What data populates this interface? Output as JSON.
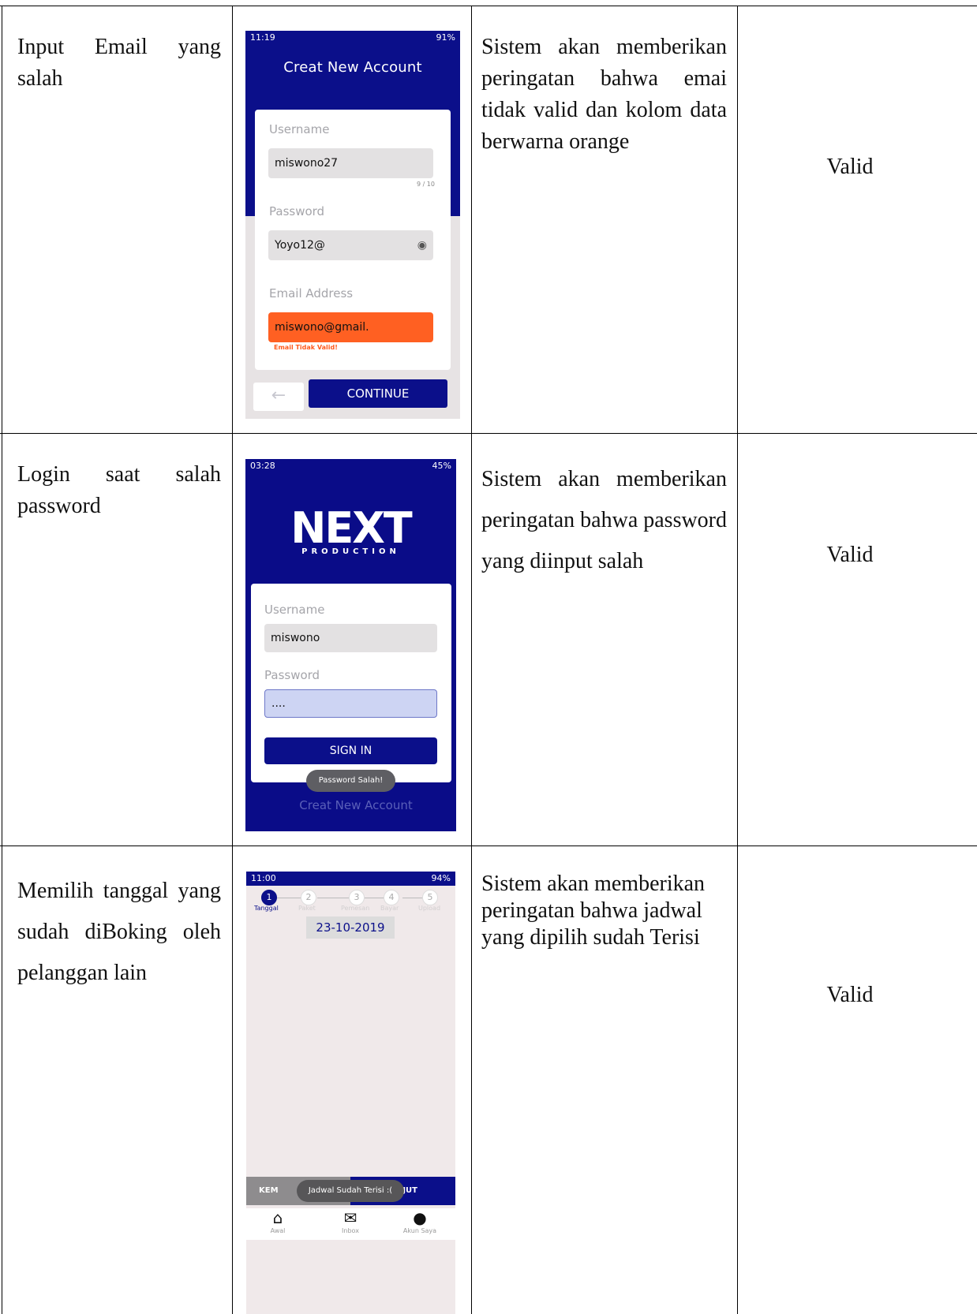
{
  "rows": [
    {
      "case": "Input Email yang salah",
      "expected": "Sistem akan memberikan peringatan bahwa emai tidak valid dan kolom data berwarna orange",
      "result": "Valid",
      "screen": {
        "time": "11:19",
        "status": "91%",
        "title": "Creat New Account",
        "username_label": "Username",
        "username_value": "miswono27",
        "counter": "9 / 10",
        "password_label": "Password",
        "password_value": "Yoyo12@",
        "email_label": "Email Address",
        "email_value": "miswono@gmail.",
        "email_error": "Email Tidak Valid!",
        "continue_label": "CONTINUE"
      }
    },
    {
      "case": "Login saat salah password",
      "expected": "Sistem akan memberikan peringatan bahwa password yang diinput salah",
      "result": "Valid",
      "screen": {
        "time": "03:28",
        "status": "45%",
        "logo": "NEXT",
        "logo_sub": "PRODUCTION",
        "username_label": "Username",
        "username_value": "miswono",
        "password_label": "Password",
        "password_value": "....",
        "signin_label": "SIGN IN",
        "toast": "Password Salah!",
        "creat_link": "Creat New Account"
      }
    },
    {
      "case": "Memilih tanggal yang sudah diBoking oleh pelanggan lain",
      "expected": "Sistem akan memberikan peringatan bahwa jadwal yang dipilih sudah Terisi",
      "result": "Valid",
      "screen": {
        "time": "11:00",
        "status": "94%",
        "steps": [
          "1",
          "2",
          "3",
          "4",
          "5"
        ],
        "step_labels": [
          "Tanggal",
          "Paket",
          "Pemesan",
          "Bayar",
          "Upload"
        ],
        "date": "23-10-2019",
        "back_label": "KEM",
        "next_label": "JUT",
        "toast": "Jadwal Sudah Terisi :(",
        "nav": [
          "Awal",
          "Inbox",
          "Akun Saya"
        ]
      }
    }
  ]
}
